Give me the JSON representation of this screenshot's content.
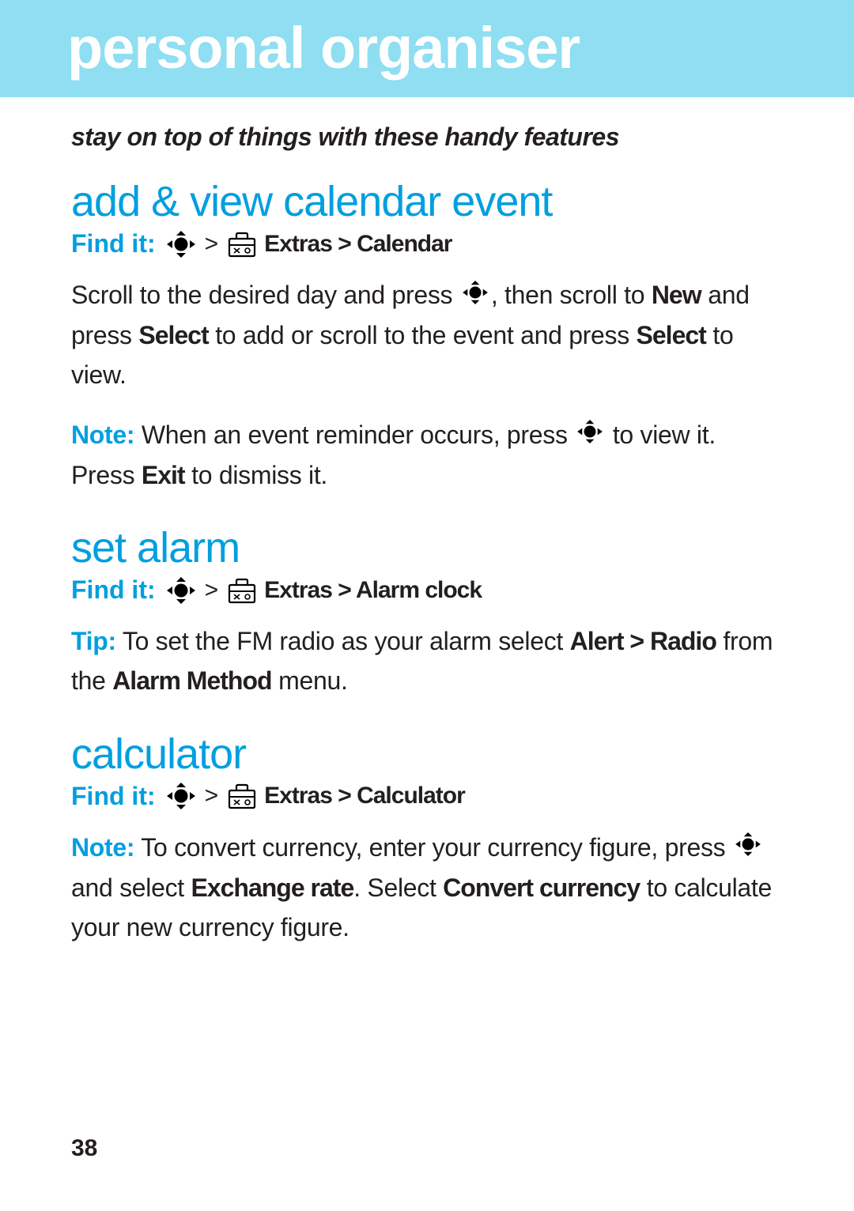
{
  "banner": {
    "title": "personal organiser"
  },
  "subtitle": "stay on top of things with these handy features",
  "sections": {
    "calendar": {
      "heading": "add & view calendar event",
      "find_it": "Find it:",
      "path": "Extras > Calendar",
      "body_pre": "Scroll to the desired day and press ",
      "body_mid1": ", then scroll to ",
      "new": "New",
      "body_mid2": " and press ",
      "select1": "Select",
      "body_mid3": " to add or scroll to the event and press ",
      "select2": "Select",
      "body_end": " to view.",
      "note_label": "Note:",
      "note_pre": " When an event reminder occurs, press ",
      "note_mid": " to view it. Press ",
      "exit": "Exit",
      "note_end": " to dismiss it."
    },
    "alarm": {
      "heading": "set alarm",
      "find_it": "Find it:",
      "path": "Extras > Alarm clock",
      "tip_label": "Tip:",
      "tip_pre": " To set the FM radio as your alarm select ",
      "alert_radio": "Alert > Radio",
      "tip_mid": " from the ",
      "alarm_method": "Alarm Method",
      "tip_end": " menu."
    },
    "calculator": {
      "heading": "calculator",
      "find_it": "Find it:",
      "path": "Extras > Calculator",
      "note_label": "Note:",
      "note_pre": " To convert currency, enter your currency figure, press ",
      "note_mid1": " and select ",
      "exchange": "Exchange rate",
      "note_mid2": ". Select ",
      "convert": "Convert currency",
      "note_end": " to calculate your new currency figure."
    }
  },
  "gt": ">",
  "page_number": "38"
}
